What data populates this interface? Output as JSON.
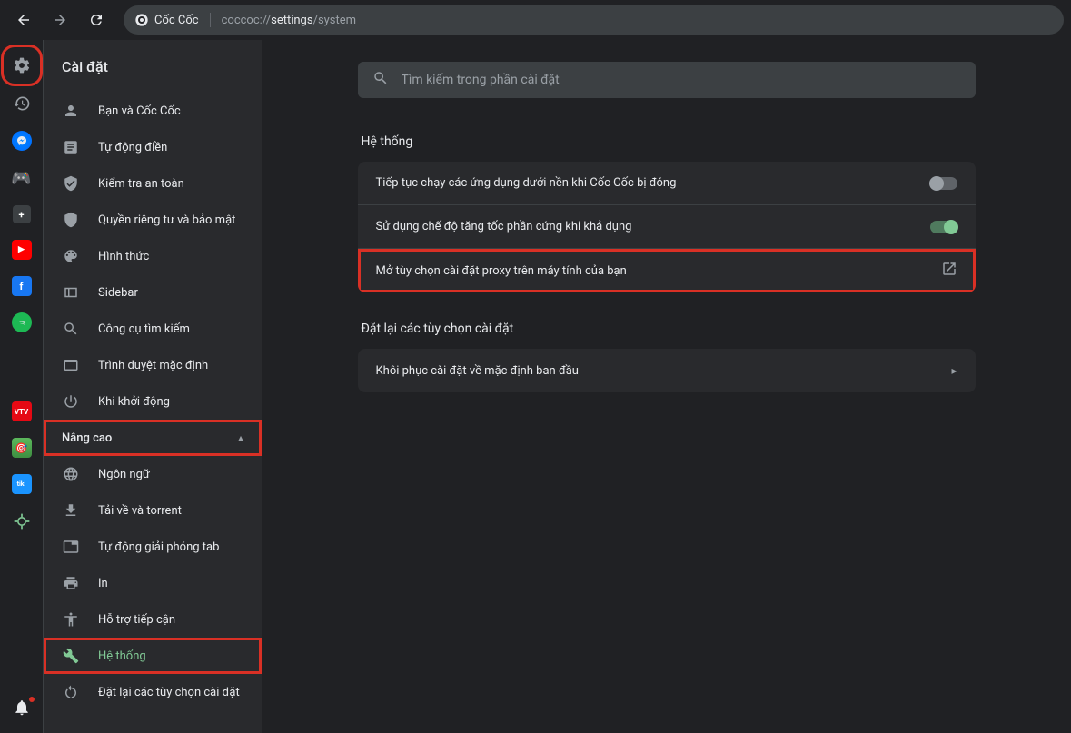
{
  "toolbar": {
    "browser_name": "Cốc Cốc",
    "url_prefix": "coccoc://",
    "url_mid": "settings",
    "url_suffix": "/system"
  },
  "settings": {
    "title": "Cài đặt",
    "search_placeholder": "Tìm kiếm trong phần cài đặt",
    "nav": [
      {
        "label": "Bạn và Cốc Cốc"
      },
      {
        "label": "Tự động điền"
      },
      {
        "label": "Kiểm tra an toàn"
      },
      {
        "label": "Quyền riêng tư và bảo mật"
      },
      {
        "label": "Hình thức"
      },
      {
        "label": "Sidebar"
      },
      {
        "label": "Công cụ tìm kiếm"
      },
      {
        "label": "Trình duyệt mặc định"
      },
      {
        "label": "Khi khởi động"
      }
    ],
    "advanced_label": "Nâng cao",
    "advanced_nav": [
      {
        "label": "Ngôn ngữ"
      },
      {
        "label": "Tải về và torrent"
      },
      {
        "label": "Tự động giải phóng tab"
      },
      {
        "label": "In"
      },
      {
        "label": "Hỗ trợ tiếp cận"
      },
      {
        "label": "Hệ thống"
      },
      {
        "label": "Đặt lại các tùy chọn cài đặt"
      }
    ]
  },
  "main": {
    "section1_title": "Hệ thống",
    "row_bg_apps": "Tiếp tục chạy các ứng dụng dưới nền khi Cốc Cốc bị đóng",
    "row_hw_accel": "Sử dụng chế độ tăng tốc phần cứng khi khả dụng",
    "row_proxy": "Mở tùy chọn cài đặt proxy trên máy tính của bạn",
    "section2_title": "Đặt lại các tùy chọn cài đặt",
    "row_reset": "Khôi phục cài đặt về mặc định ban đầu"
  }
}
